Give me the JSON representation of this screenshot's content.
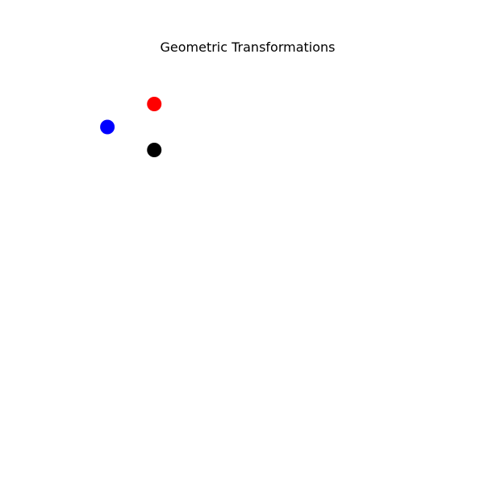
{
  "chart_data": {
    "type": "scatter",
    "title": "Geometric Transformations",
    "xlabel": "",
    "ylabel": "",
    "xlim": [
      -4,
      4
    ],
    "ylim": [
      -4,
      4
    ],
    "grid": false,
    "axes_visible": false,
    "series": [
      {
        "color": "#ff0000",
        "points": [
          {
            "x": -2,
            "y": 3
          }
        ]
      },
      {
        "color": "#0000ff",
        "points": [
          {
            "x": -3,
            "y": 2.5
          }
        ]
      },
      {
        "color": "#000000",
        "points": [
          {
            "x": -2,
            "y": 2
          }
        ]
      }
    ]
  }
}
